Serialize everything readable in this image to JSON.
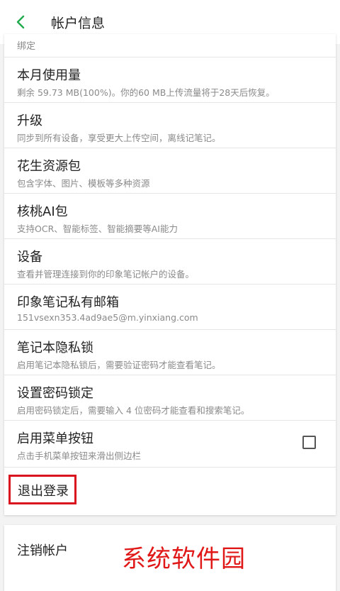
{
  "header": {
    "title": "帐户信息",
    "back_icon": "chevron-left-icon",
    "accent_color": "#1faa4c"
  },
  "partial_item": {
    "title": "绑定"
  },
  "items": [
    {
      "title": "本月使用量",
      "subtitle": "剩余 59.73 MB(100%)。你的60 MB上传流量将于28天后恢复。"
    },
    {
      "title": "升级",
      "subtitle": "同步到所有设备，享受更大上传空间，离线记笔记。"
    },
    {
      "title": "花生资源包",
      "subtitle": "包含字体、图片、模板等多种资源"
    },
    {
      "title": "核桃AI包",
      "subtitle": "支持OCR、智能标签、智能摘要等AI能力"
    },
    {
      "title": "设备",
      "subtitle": "查看并管理连接到你的印象笔记帐户的设备。"
    },
    {
      "title": "印象笔记私有邮箱",
      "subtitle": "151vsexn353.4ad9ae5@m.yinxiang.com"
    },
    {
      "title": "笔记本隐私锁",
      "subtitle": "启用笔记本隐私锁后，需要验证密码才能查看笔记。"
    },
    {
      "title": "设置密码锁定",
      "subtitle": "启用密码锁定后，需要输入 4 位密码才能查看和搜索笔记。"
    },
    {
      "title": "启用菜单按钮",
      "subtitle": "点击手机菜单按钮来滑出侧边栏",
      "checked": false
    }
  ],
  "logout": {
    "label": "退出登录",
    "highlight_color": "#d9141e"
  },
  "delete_account": {
    "label": "注销帐户"
  },
  "watermark": {
    "text": "系统软件园",
    "color": "#e01818"
  }
}
